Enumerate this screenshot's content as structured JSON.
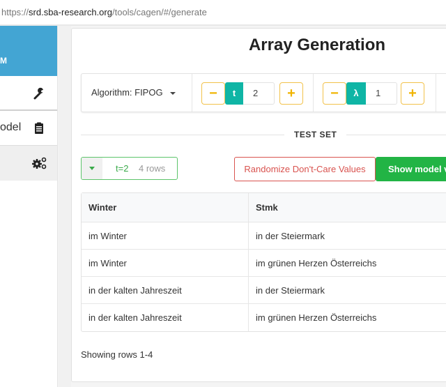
{
  "browser": {
    "url_prefix": "https://",
    "url_host": "srd.sba-research.org",
    "url_path": "/tools/cagen/#/generate"
  },
  "sidebar": {
    "brand": "M",
    "items": [
      {
        "label": "",
        "icon": "wrench-icon"
      },
      {
        "label": "odel",
        "icon": "clipboard-icon"
      },
      {
        "label": "",
        "icon": "cogs-icon",
        "active": true
      }
    ]
  },
  "main": {
    "title": "Array Generation",
    "toolbar": {
      "algorithm_label": "Algorithm: FIPOG",
      "t_stepper": {
        "tag": "t",
        "value": "2",
        "minus": "−",
        "plus": "+"
      },
      "lambda_stepper": {
        "tag": "λ",
        "value": "1",
        "minus": "−",
        "plus": "+"
      }
    },
    "section_label": "TEST SET",
    "row_selector": {
      "t_label": "t=2",
      "rows_label": "4 rows"
    },
    "buttons": {
      "randomize": "Randomize Don't-Care Values",
      "show_model": "Show model va"
    },
    "table": {
      "columns": [
        "Winter",
        "Stmk"
      ],
      "rows": [
        [
          "im Winter",
          "in der Steiermark"
        ],
        [
          "im Winter",
          "im grünen Herzen Österreichs"
        ],
        [
          "in der kalten Jahreszeit",
          "in der Steiermark"
        ],
        [
          "in der kalten Jahreszeit",
          "im grünen Herzen Österreichs"
        ]
      ]
    },
    "footer": "Showing rows 1-4"
  },
  "colors": {
    "sidebar_header": "#43a5d3",
    "teal_tag": "#0fb5a5",
    "stepper_border": "#f2c24a",
    "danger": "#d9534f",
    "success": "#22b445"
  }
}
